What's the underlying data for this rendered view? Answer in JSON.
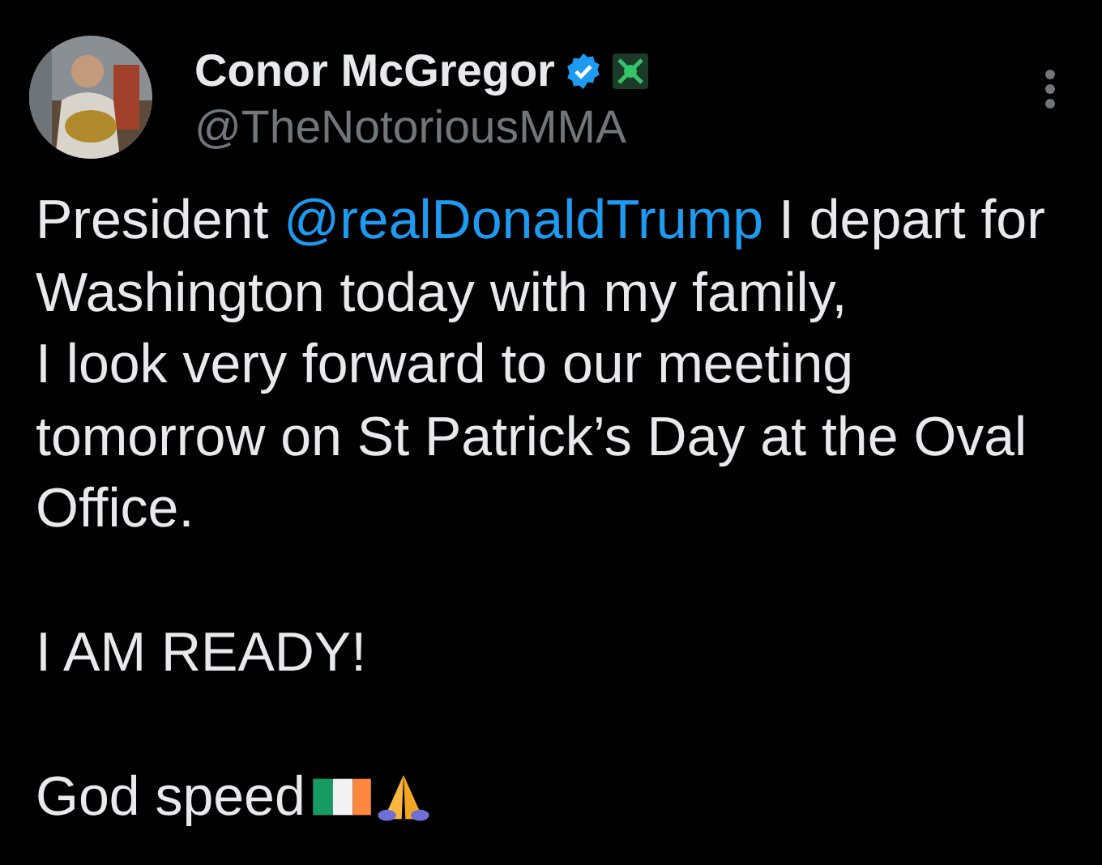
{
  "author": {
    "name": "Conor McGregor",
    "handle": "@TheNotoriousMMA",
    "verified": true
  },
  "paragraphs": [
    {
      "before": "President ",
      "mention": "@realDonaldTrump",
      "after": " I depart for Washington today with my family,\nI look very forward to our meeting tomorrow on St Patrick’s Day at the Oval Office."
    },
    {
      "before": "I AM READY!"
    },
    {
      "before": "God speed",
      "emoji": [
        {
          "kind": "flag"
        },
        {
          "kind": "praying-hands"
        }
      ]
    }
  ]
}
